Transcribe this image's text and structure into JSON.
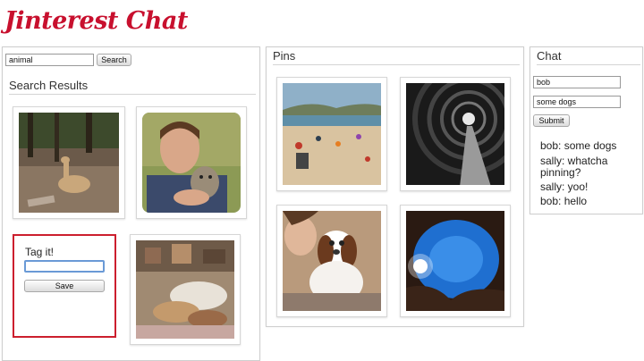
{
  "app": {
    "logo_text": "Jinterest Chat"
  },
  "search": {
    "query_value": "animal",
    "button_label": "Search",
    "results_title": "Search Results"
  },
  "results": [
    {
      "name": "result-llama-photo"
    },
    {
      "name": "result-man-kitten-photo"
    },
    {
      "name": "result-cats-sleeping-photo"
    }
  ],
  "tag_dialog": {
    "title": "Tag it!",
    "input_value": "",
    "save_label": "Save",
    "border_color": "#cc1f2e"
  },
  "pins": {
    "title": "Pins",
    "items": [
      {
        "name": "pin-beach-photo"
      },
      {
        "name": "pin-tunnel-photo"
      },
      {
        "name": "pin-puppy-photo"
      },
      {
        "name": "pin-sky-cave-photo"
      }
    ]
  },
  "chat": {
    "title": "Chat",
    "name_value": "bob",
    "message_value": "some dogs",
    "submit_label": "Submit",
    "messages": [
      "bob: some dogs",
      "sally: whatcha",
      "pinning?",
      "sally: yoo!",
      "bob: hello"
    ]
  },
  "colors": {
    "brand": "#c8102e",
    "panel_border": "#cfcfcf"
  }
}
